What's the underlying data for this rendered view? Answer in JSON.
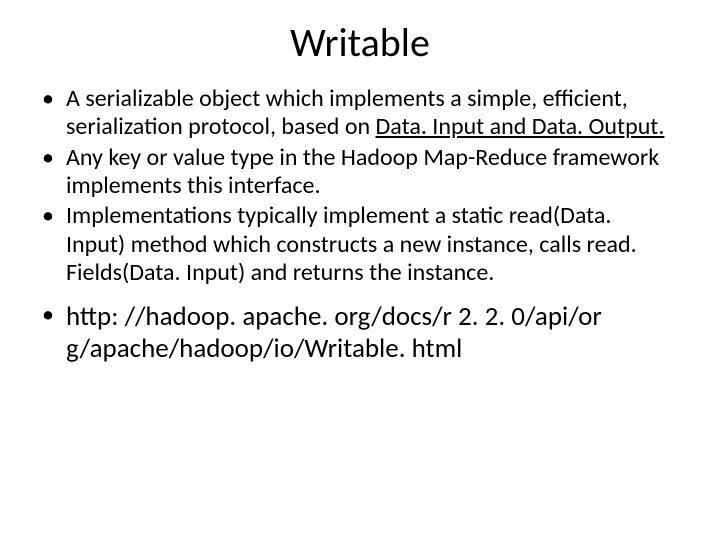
{
  "title": "Writable",
  "bullets_a": [
    {
      "pre": "A serializable object which implements a simple, efficient, serialization protocol, based on ",
      "link": "Data. Input and Data. Output."
    },
    {
      "pre": "Any key or value type in the Hadoop Map-Reduce framework implements this interface."
    },
    {
      "pre": "Implementations typically implement a static read(Data. Input) method which constructs a new instance, calls read. Fields(Data. Input) and returns the instance."
    }
  ],
  "bullets_b": [
    {
      "pre": "http: //hadoop. apache. org/docs/r 2. 2. 0/api/or g/apache/hadoop/io/Writable. html"
    }
  ]
}
